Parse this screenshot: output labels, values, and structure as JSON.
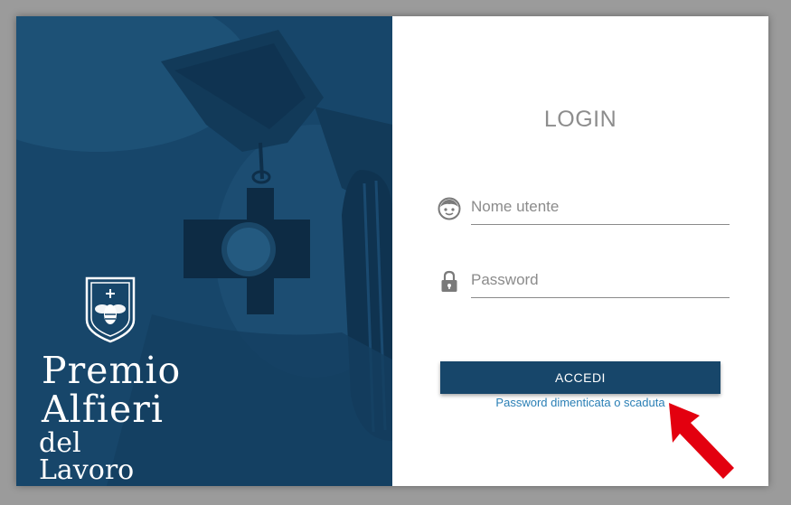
{
  "brand": {
    "line1": "Premio",
    "line2": "Alfieri",
    "line3": "del Lavoro"
  },
  "login": {
    "title": "LOGIN",
    "username_placeholder": "Nome utente",
    "password_placeholder": "Password",
    "submit_label": "ACCEDI",
    "forgot_link": "Password dimenticata o scaduta"
  },
  "icons": {
    "username": "user-face-icon",
    "password": "padlock-icon",
    "annotation": "red-arrow-icon"
  },
  "colors": {
    "brand_blue": "#17466a",
    "link_blue": "#2a7fb5",
    "annotation_red": "#e3000f"
  }
}
